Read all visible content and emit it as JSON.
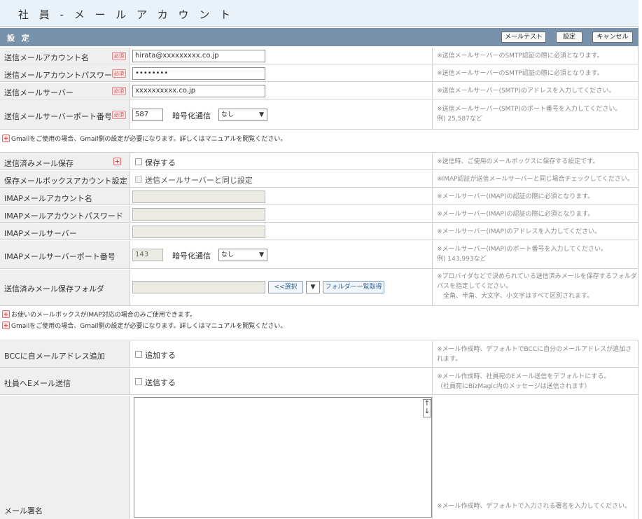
{
  "page": {
    "title": "社 員 - メ ー ル ア カ ウ ン ト",
    "section_title": "設 定"
  },
  "toolbar": {
    "mail_test": "メールテスト",
    "save": "設定",
    "cancel": "キャンセル"
  },
  "badges": {
    "required": "必須",
    "info_mark": "+"
  },
  "fields": {
    "send_account": {
      "label": "送信メールアカウント名",
      "value": "hirata@xxxxxxxxx.co.jp",
      "note": "※送信メールサーバーのSMTP認証の際に必須となります。"
    },
    "send_password": {
      "label": "送信メールアカウントパスワード",
      "value": "••••••••",
      "note": "※送信メールサーバーのSMTP認証の際に必須となります。"
    },
    "send_server": {
      "label": "送信メールサーバー",
      "value": "xxxxxxxxxx.co.jp",
      "note": "※送信メールサーバー(SMTP)のアドレスを入力してください。"
    },
    "send_port": {
      "label": "送信メールサーバーポート番号",
      "value": "587",
      "enc_label": "暗号化通信",
      "enc_value": "なし",
      "note1": "※送信メールサーバー(SMTP)のポート番号を入力してください。",
      "note2": "例) 25,587など"
    },
    "info_gmail_1": "Gmailをご使用の場合、Gmail側の設定が必要になります。詳しくはマニュアルを閲覧ください。",
    "sent_save": {
      "label": "送信済みメール保存",
      "checkbox_label": "保存する",
      "note": "※送信時、ご使用のメールボックスに保存する設定です。"
    },
    "sent_box_account": {
      "label": "保存メールボックスアカウント設定",
      "checkbox_label": "送信メールサーバーと同じ設定",
      "note": "※IMAP認証が送信メールサーバーと同じ場合チェックしてください。"
    },
    "imap_account": {
      "label": "IMAPメールアカウント名",
      "value": "",
      "note": "※メールサーバー(IMAP)の認証の際に必須となります。"
    },
    "imap_password": {
      "label": "IMAPメールアカウントパスワード",
      "value": "",
      "note": "※メールサーバー(IMAP)の認証の際に必須となります。"
    },
    "imap_server": {
      "label": "IMAPメールサーバー",
      "value": "",
      "note": "※メールサーバー(IMAP)のアドレスを入力してください。"
    },
    "imap_port": {
      "label": "IMAPメールサーバーポート番号",
      "value": "143",
      "enc_label": "暗号化通信",
      "enc_value": "なし",
      "note1": "※メールサーバー(IMAP)のポート番号を入力してください。",
      "note2": "例) 143,993など"
    },
    "sent_folder": {
      "label": "送信済みメール保存フォルダ",
      "value": "",
      "select_button": "<<選択",
      "dropdown_glyph": "▼",
      "fetch_button": "フォルダー一覧取得",
      "note1": "※プロバイダなどで決められている送信済みメールを保存するフォルダ",
      "note2": "パスを指定してください。",
      "note3": "　全角、半角、大文字、小文字はすべて区別されます。"
    },
    "info_imap": "お使いのメールボックスがIMAP対応の場合のみご使用できます。",
    "info_gmail_2": "Gmailをご使用の場合、Gmail側の設定が必要になります。詳しくはマニュアルを閲覧ください。",
    "bcc_self": {
      "label": "BCCに自メールアドレス追加",
      "checkbox_label": "追加する",
      "note1": "※メール作成時、デフォルトでBCCに自分のメールアドレスが追加さ",
      "note2": "れます。"
    },
    "employee_email": {
      "label": "社員へEメール送信",
      "checkbox_label": "送信する",
      "note1": "※メール作成時、社員宛のEメール送信をデフォルトにする。",
      "note2": "（社員宛にBizMagic内のメッセージは送信されます）"
    },
    "signature": {
      "label": "メール署名",
      "value": "",
      "note": "※メール作成時、デフォルトで入力される署名を入力してください。"
    }
  },
  "icons": {
    "dropdown": "▼",
    "resize_up": "↑",
    "resize_down": "↓"
  }
}
